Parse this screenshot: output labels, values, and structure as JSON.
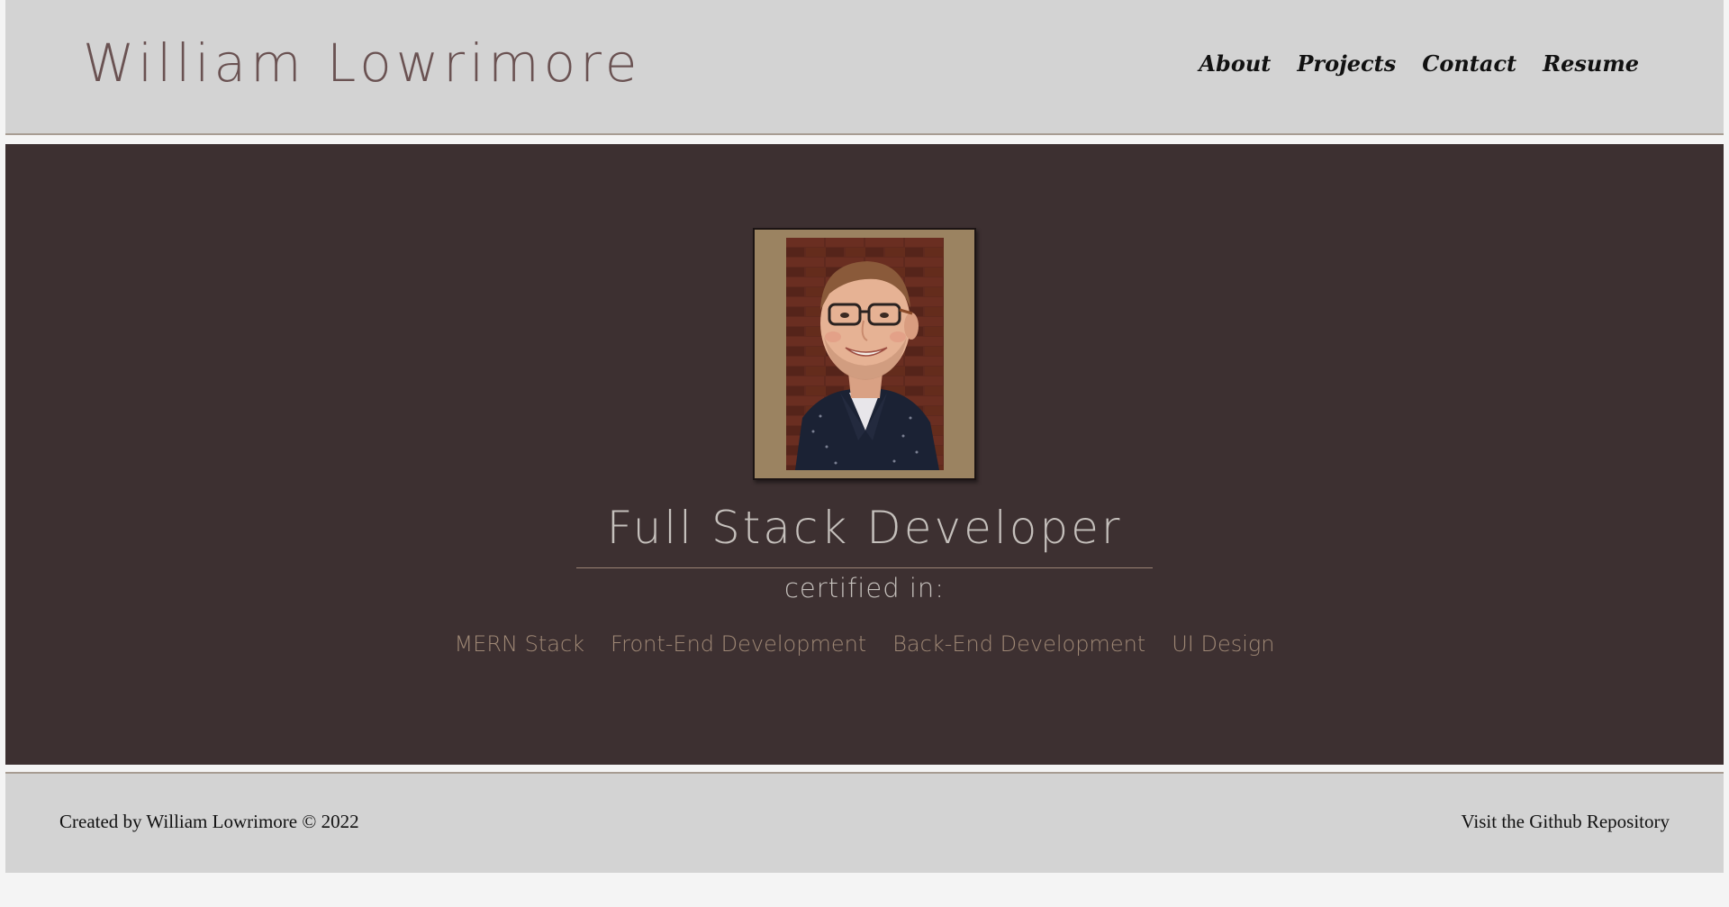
{
  "header": {
    "site_title": "William Lowrimore",
    "nav": [
      {
        "label": "About"
      },
      {
        "label": "Projects"
      },
      {
        "label": "Contact"
      },
      {
        "label": "Resume"
      }
    ]
  },
  "hero": {
    "photo_alt": "portrait-photo",
    "role_title": "Full Stack Developer",
    "cert_label": "certified in:",
    "certifications": [
      "MERN Stack",
      "Front-End Development",
      "Back-End Development",
      "UI Design"
    ]
  },
  "footer": {
    "credit": "Created by William Lowrimore © 2022",
    "repo_link": "Visit the Github Repository"
  },
  "colors": {
    "header_bg": "#d3d3d3",
    "hero_bg": "#3d3031",
    "frame_bg": "#9b8361",
    "title_color": "#6a5252",
    "cert_color": "#9f8875"
  }
}
